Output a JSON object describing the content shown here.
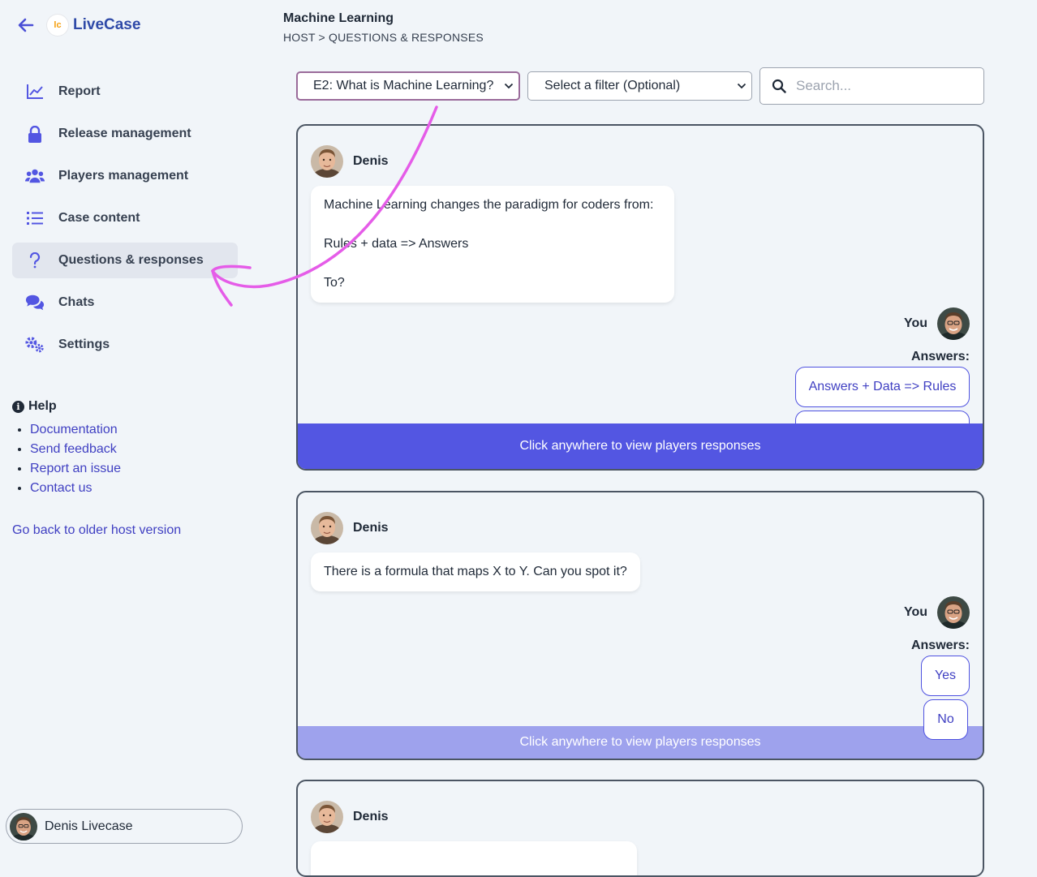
{
  "app": {
    "name": "LiveCase"
  },
  "sidebar": {
    "items": [
      {
        "label": "Report",
        "icon": "chart-line-icon",
        "active": false
      },
      {
        "label": "Release management",
        "icon": "lock-icon",
        "active": false
      },
      {
        "label": "Players management",
        "icon": "users-icon",
        "active": false
      },
      {
        "label": "Case content",
        "icon": "list-icon",
        "active": false
      },
      {
        "label": "Questions & responses",
        "icon": "question-icon",
        "active": true
      },
      {
        "label": "Chats",
        "icon": "comments-icon",
        "active": false
      },
      {
        "label": "Settings",
        "icon": "gears-icon",
        "active": false
      }
    ],
    "help": {
      "title": "Help",
      "links": [
        "Documentation",
        "Send feedback",
        "Report an issue",
        "Contact us"
      ]
    },
    "older_link": "Go back to older host version",
    "user": {
      "name": "Denis Livecase"
    }
  },
  "header": {
    "title": "Machine Learning",
    "breadcrumb": "HOST > QUESTIONS & RESPONSES"
  },
  "filters": {
    "episode_select": "E2: What is Machine Learning?",
    "filter_select": "Select a filter (Optional)",
    "search_placeholder": "Search..."
  },
  "cards": [
    {
      "speaker": "Denis",
      "message_lines": [
        "Machine Learning changes the paradigm for coders from:",
        "Rules + data => Answers",
        "To?"
      ],
      "you_label": "You",
      "answers_label": "Answers:",
      "answers": [
        "Answers + Data => Rules"
      ],
      "view_label": "Click anywhere to view players responses"
    },
    {
      "speaker": "Denis",
      "message_lines": [
        "There is a formula that maps X to Y. Can you spot it?"
      ],
      "you_label": "You",
      "answers_label": "Answers:",
      "answers": [
        "Yes",
        "No"
      ],
      "view_label": "Click anywhere to view players responses"
    },
    {
      "speaker": "Denis"
    }
  ],
  "colors": {
    "accent": "#5356e2",
    "link": "#3f3fc2",
    "background": "#f1f5f9",
    "annotation": "#e55ce8"
  }
}
